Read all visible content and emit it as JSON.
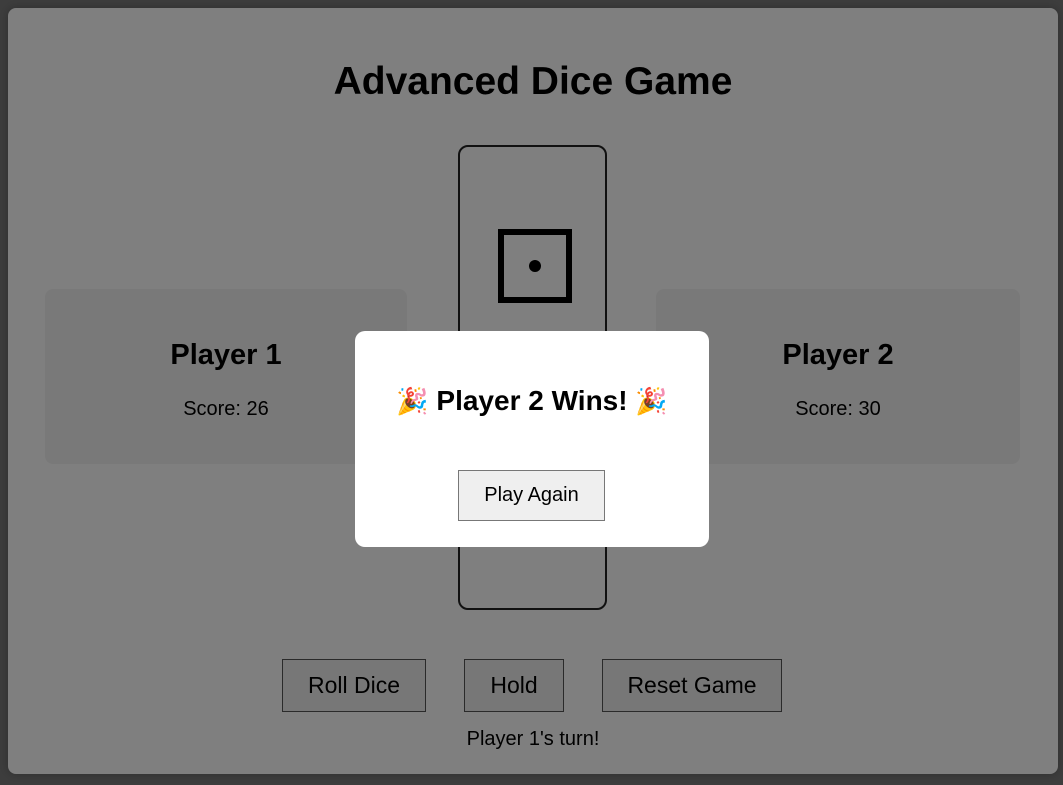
{
  "game": {
    "title": "Advanced Dice Game",
    "turn_text": "Player 1's turn!"
  },
  "players": [
    {
      "name": "Player 1",
      "score_text": "Score: 26",
      "score": 26
    },
    {
      "name": "Player 2",
      "score_text": "Score: 30",
      "score": 30
    }
  ],
  "dice": {
    "value": 1,
    "icon": "die-face-one-icon"
  },
  "controls": {
    "roll_label": "Roll Dice",
    "hold_label": "Hold",
    "reset_label": "Reset Game"
  },
  "modal": {
    "message": "Player 2 Wins!",
    "celebration_icon": "🎉",
    "button_label": "Play Again"
  },
  "colors": {
    "overlay": "rgba(0,0,0,0.5)",
    "card_bg": "#f3f3f3",
    "button_bg": "#efefef"
  }
}
